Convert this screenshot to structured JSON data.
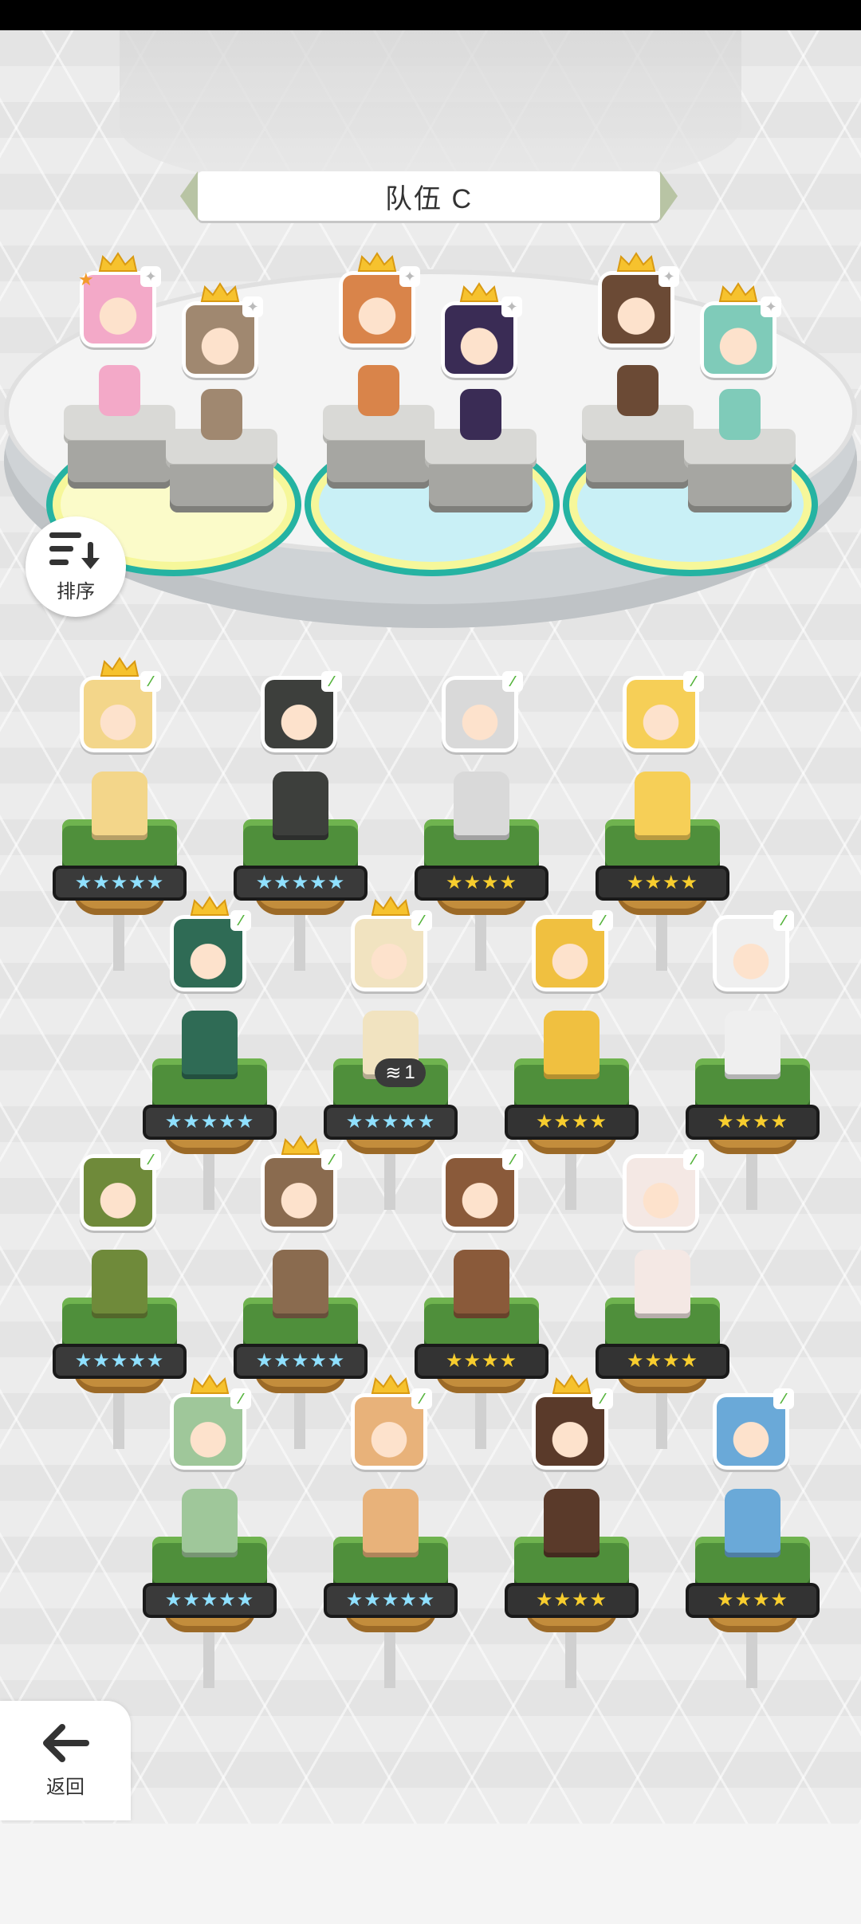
{
  "team": {
    "title": "队伍 C"
  },
  "buttons": {
    "sort_label": "排序",
    "back_label": "返回"
  },
  "unit_badge": {
    "count": "1"
  },
  "icons": {
    "sort": "sort-descending-icon",
    "back": "arrow-left-icon",
    "crown": "crown-icon",
    "leaf": "leaf-tag-icon",
    "star": "star-icon",
    "layers": "layers-icon"
  },
  "colors": {
    "grass": "#4f8f3b",
    "dirt": "#c38d3c",
    "star_gold": "#f7cd2e",
    "star_rainbow": "#8fe0ff",
    "accent_teal": "#25b3a2"
  },
  "team_members": [
    {
      "slot": 1,
      "crown": true,
      "leader": true,
      "hair": "#f3a9c8"
    },
    {
      "slot": 2,
      "crown": true,
      "leader": false,
      "hair": "#a08870"
    },
    {
      "slot": 3,
      "crown": true,
      "leader": false,
      "hair": "#d9844a"
    },
    {
      "slot": 4,
      "crown": true,
      "leader": false,
      "hair": "#3a2c55"
    },
    {
      "slot": 5,
      "crown": true,
      "leader": false,
      "hair": "#6b4a35"
    },
    {
      "slot": 6,
      "crown": true,
      "leader": false,
      "hair": "#7fcbb9"
    }
  ],
  "roster": [
    {
      "crown": true,
      "stars": 5,
      "rainbow": true,
      "color": "#f3d68a"
    },
    {
      "crown": false,
      "stars": 5,
      "rainbow": true,
      "color": "#3d3f3c"
    },
    {
      "crown": false,
      "stars": 4,
      "rainbow": false,
      "color": "#d9d9d9"
    },
    {
      "crown": false,
      "stars": 4,
      "rainbow": false,
      "color": "#f6cf57"
    },
    {
      "crown": true,
      "stars": 5,
      "rainbow": true,
      "color": "#2f6b55"
    },
    {
      "crown": true,
      "stars": 5,
      "rainbow": true,
      "color": "#f1e3c0"
    },
    {
      "crown": false,
      "stars": 4,
      "rainbow": false,
      "color": "#f0c040"
    },
    {
      "crown": false,
      "stars": 4,
      "rainbow": false,
      "color": "#efefef"
    },
    {
      "crown": false,
      "stars": 5,
      "rainbow": true,
      "color": "#6f8a3a"
    },
    {
      "crown": true,
      "stars": 5,
      "rainbow": true,
      "color": "#8a6b4f"
    },
    {
      "crown": false,
      "stars": 4,
      "rainbow": false,
      "color": "#8a5a3a"
    },
    {
      "crown": false,
      "stars": 4,
      "rainbow": false,
      "color": "#f4e8e4"
    },
    {
      "crown": true,
      "stars": 5,
      "rainbow": true,
      "color": "#9fc79a"
    },
    {
      "crown": true,
      "stars": 5,
      "rainbow": true,
      "color": "#e8b27a"
    },
    {
      "crown": true,
      "stars": 4,
      "rainbow": false,
      "color": "#5a3a2a"
    },
    {
      "crown": false,
      "stars": 4,
      "rainbow": false,
      "color": "#6aa9d8"
    }
  ]
}
